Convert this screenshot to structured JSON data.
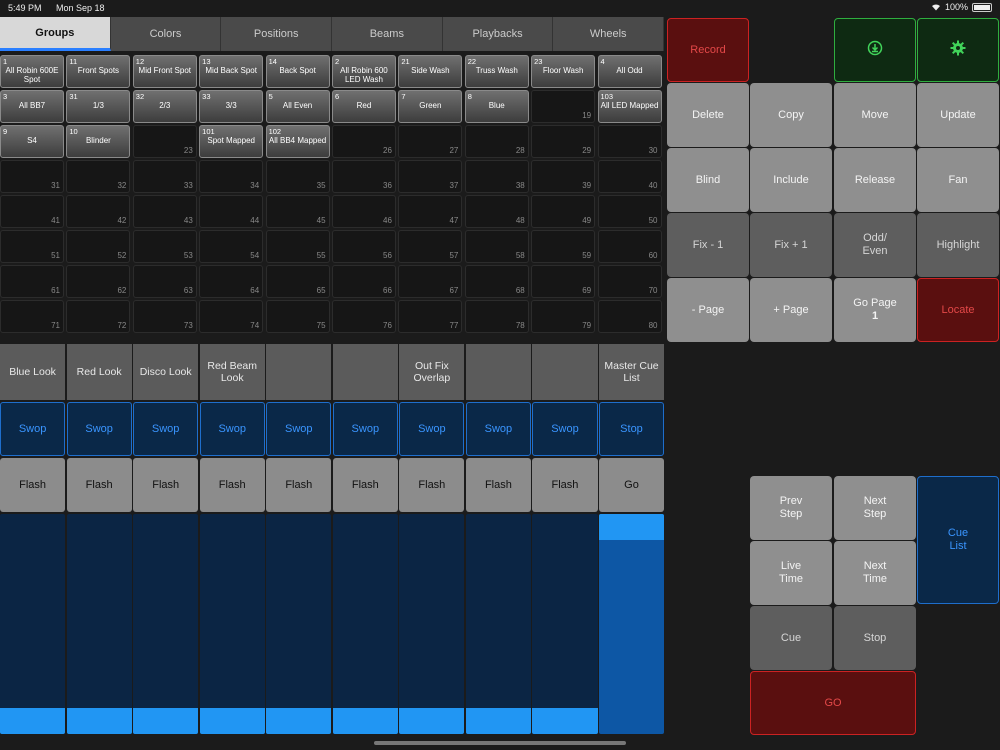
{
  "status": {
    "time": "5:49 PM",
    "date": "Mon Sep 18",
    "battery": "100%"
  },
  "tabs": [
    "Groups",
    "Colors",
    "Positions",
    "Beams",
    "Playbacks",
    "Wheels"
  ],
  "active_tab": "Groups",
  "grid": [
    {
      "id": "1",
      "label": "All Robin 600E Spot"
    },
    {
      "id": "11",
      "label": "Front Spots"
    },
    {
      "id": "12",
      "label": "Mid Front Spot"
    },
    {
      "id": "13",
      "label": "Mid Back Spot"
    },
    {
      "id": "14",
      "label": "Back Spot"
    },
    {
      "id": "2",
      "label": "All Robin 600 LED Wash"
    },
    {
      "id": "21",
      "label": "Side Wash"
    },
    {
      "id": "22",
      "label": "Truss Wash"
    },
    {
      "id": "23",
      "label": "Floor Wash"
    },
    {
      "id": "4",
      "label": "All Odd"
    },
    {
      "id": "3",
      "label": "All BB7"
    },
    {
      "id": "31",
      "label": "1/3"
    },
    {
      "id": "32",
      "label": "2/3"
    },
    {
      "id": "33",
      "label": "3/3"
    },
    {
      "id": "5",
      "label": "All Even"
    },
    {
      "id": "6",
      "label": "Red"
    },
    {
      "id": "7",
      "label": "Green"
    },
    {
      "id": "8",
      "label": "Blue"
    },
    {
      "num": "19"
    },
    {
      "id": "103",
      "label": "All LED Mapped"
    },
    {
      "id": "9",
      "label": "S4"
    },
    {
      "id": "10",
      "label": "Blinder"
    },
    {
      "num": "23"
    },
    {
      "id": "101",
      "label": "Spot Mapped"
    },
    {
      "id": "102",
      "label": "All BB4 Mapped"
    },
    {
      "num": "26"
    },
    {
      "num": "27"
    },
    {
      "num": "28"
    },
    {
      "num": "29"
    },
    {
      "num": "30"
    },
    {
      "num": "31"
    },
    {
      "num": "32"
    },
    {
      "num": "33"
    },
    {
      "num": "34"
    },
    {
      "num": "35"
    },
    {
      "num": "36"
    },
    {
      "num": "37"
    },
    {
      "num": "38"
    },
    {
      "num": "39"
    },
    {
      "num": "40"
    },
    {
      "num": "41"
    },
    {
      "num": "42"
    },
    {
      "num": "43"
    },
    {
      "num": "44"
    },
    {
      "num": "45"
    },
    {
      "num": "46"
    },
    {
      "num": "47"
    },
    {
      "num": "48"
    },
    {
      "num": "49"
    },
    {
      "num": "50"
    },
    {
      "num": "51"
    },
    {
      "num": "52"
    },
    {
      "num": "53"
    },
    {
      "num": "54"
    },
    {
      "num": "55"
    },
    {
      "num": "56"
    },
    {
      "num": "57"
    },
    {
      "num": "58"
    },
    {
      "num": "59"
    },
    {
      "num": "60"
    },
    {
      "num": "61"
    },
    {
      "num": "62"
    },
    {
      "num": "63"
    },
    {
      "num": "64"
    },
    {
      "num": "65"
    },
    {
      "num": "66"
    },
    {
      "num": "67"
    },
    {
      "num": "68"
    },
    {
      "num": "69"
    },
    {
      "num": "70"
    },
    {
      "num": "71"
    },
    {
      "num": "72"
    },
    {
      "num": "73"
    },
    {
      "num": "74"
    },
    {
      "num": "75"
    },
    {
      "num": "76"
    },
    {
      "num": "77"
    },
    {
      "num": "78"
    },
    {
      "num": "79"
    },
    {
      "num": "80"
    }
  ],
  "playbacks": {
    "labels": [
      "Blue Look",
      "Red Look",
      "Disco Look",
      "Red Beam Look",
      "",
      "",
      "Out Fix Overlap",
      "",
      "",
      "Master Cue List"
    ],
    "swop": [
      "Swop",
      "Swop",
      "Swop",
      "Swop",
      "Swop",
      "Swop",
      "Swop",
      "Swop",
      "Swop",
      "Stop"
    ],
    "flash": [
      "Flash",
      "Flash",
      "Flash",
      "Flash",
      "Flash",
      "Flash",
      "Flash",
      "Flash",
      "Flash",
      "Go"
    ],
    "fader_levels": [
      0,
      0,
      0,
      0,
      0,
      0,
      0,
      0,
      0,
      1
    ]
  },
  "buttons": {
    "record": "Record",
    "delete": "Delete",
    "copy": "Copy",
    "move": "Move",
    "update": "Update",
    "blind": "Blind",
    "include": "Include",
    "release": "Release",
    "fan": "Fan",
    "fix_minus": "Fix - 1",
    "fix_plus": "Fix + 1",
    "odd_even": "Odd/ Even",
    "highlight": "Highlight",
    "page_minus": "- Page",
    "page_plus": "+ Page",
    "go_page": "Go Page",
    "go_page_num": "1",
    "locate": "Locate",
    "prev_step": "Prev Step",
    "next_step": "Next Step",
    "live_time": "Live Time",
    "next_time": "Next Time",
    "cue": "Cue",
    "stop": "Stop",
    "go": "GO",
    "cue_list": "Cue List"
  },
  "icons": {
    "save": "download-circle-icon",
    "settings": "gear-icon"
  },
  "colors": {
    "accent_blue": "#2196f3",
    "record_red": "#5a0f0f",
    "green": "#2fae3f"
  }
}
